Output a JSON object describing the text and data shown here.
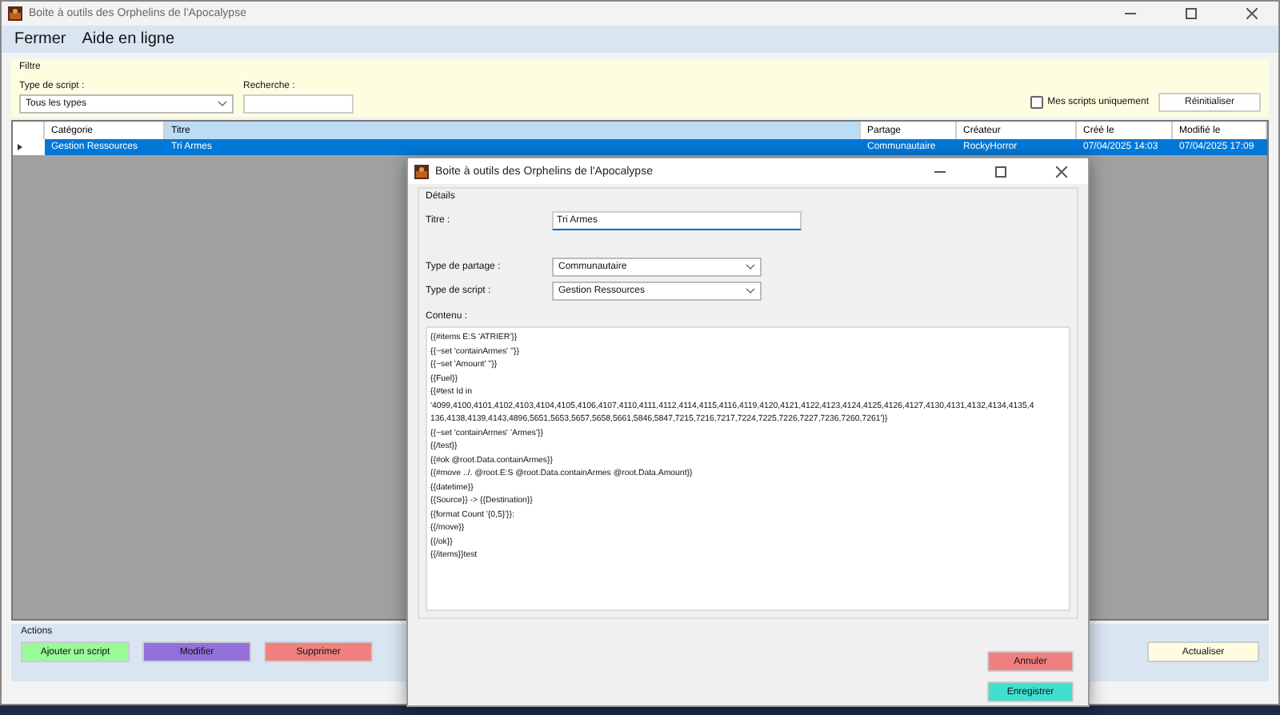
{
  "window": {
    "title": "Boite à outils des Orphelins de l'Apocalypse"
  },
  "menu": [
    "Fermer",
    "Aide en ligne"
  ],
  "filter": {
    "title": "Filtre",
    "script_type_label": "Type de script :",
    "script_type_value": "Tous les types",
    "search_label": "Recherche :",
    "my_scripts": {
      "label": "Mes scripts uniquement",
      "checked": false
    },
    "reset_button": "Réinitialiser"
  },
  "table": {
    "columns": [
      "Catégorie",
      "Titre",
      "Partage",
      "Créateur",
      "Créé le",
      "Modifié le"
    ],
    "rows": [
      {
        "selected": true,
        "cells": [
          "Gestion Ressources",
          "Tri Armes",
          "Communautaire",
          "RockyHorror",
          "07/04/2025 14:03",
          "07/04/2025 17:09"
        ]
      }
    ]
  },
  "actions": {
    "title": "Actions",
    "buttons": [
      {
        "label": "Ajouter un script",
        "color": "#98fb98"
      },
      {
        "label": "Modifier",
        "color": "#9370db"
      },
      {
        "label": "Supprimer",
        "color": "#f08080"
      }
    ],
    "refresh_button": "Actualiser"
  },
  "dialog": {
    "title": "Boite à outils des Orphelins de l'Apocalypse",
    "group": "Détails",
    "title_label": "Titre :",
    "title_value": "Tri Armes",
    "sharing_label": "Type de partage :",
    "sharing_value": "Communautaire",
    "script_type_label": "Type de script :",
    "script_type_value": "Gestion Ressources",
    "content_label": "Contenu :",
    "content_lines": [
      "{{#items E:S 'ATRIER'}}",
      "{{~set 'containArmes' ''}}",
      "{{~set 'Amount' ''}}",
      "{{Fuel}}",
      "{{#test Id in",
      "'4099,4100,4101,4102,4103,4104,4105,4106,4107,4110,4111,4112,4114,4115,4116,4119,4120,4121,4122,4123,4124,4125,4126,4127,4130,4131,4132,4134,4135,4",
      "136,4138,4139,4143,4896,5651,5653,5657,5658,5661,5846,5847,7215,7216,7217,7224,7225,7226,7227,7236,7260,7261'}}",
      "{{~set 'containArmes' 'Armes'}}",
      "{{/test}}",
      "{{#ok @root.Data.containArmes}}",
      "{{#move ../. @root.E:S @root.Data.containArmes @root.Data.Amount}}",
      "{{datetime}}",
      "{{Source}} -> {{Destination}}",
      "{{format Count '{0,5}'}}:",
      "{{/move}}",
      "{{/ok}}",
      "{{/items}}test"
    ],
    "buttons": [
      {
        "label": "Annuler",
        "color": "#f08080"
      },
      {
        "label": "Enregistrer",
        "color": "#40e0d0"
      }
    ]
  }
}
